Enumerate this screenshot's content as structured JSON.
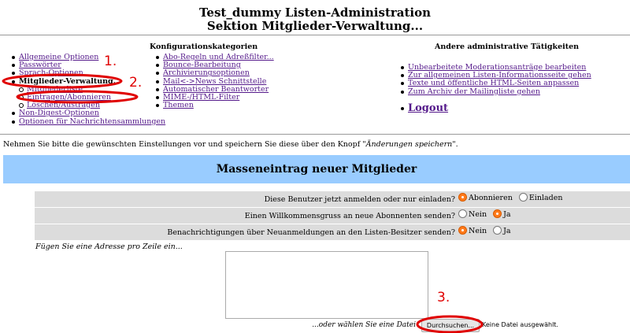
{
  "header": {
    "title_line1": "Test_dummy Listen-Administration",
    "title_line2": "Sektion Mitglieder-Verwaltung..."
  },
  "categories": {
    "heading": "Konfigurationskategorien",
    "col1": [
      {
        "label": "Allgemeine Optionen",
        "type": "link"
      },
      {
        "label": "Passwörter",
        "type": "link"
      },
      {
        "label": "Sprach-Optionen",
        "type": "link"
      },
      {
        "label": "Mitglieder-Verwaltung...",
        "type": "bold"
      },
      {
        "label": "Mitgliederliste",
        "type": "sublink"
      },
      {
        "label": "Eintragen/Abonnieren",
        "type": "sublink"
      },
      {
        "label": "Löschen/Austragen",
        "type": "sublink"
      },
      {
        "label": "Non-Digest-Optionen",
        "type": "link"
      },
      {
        "label": "Optionen für Nachrichtensammlungen",
        "type": "link"
      }
    ],
    "col2": [
      "Abo-Regeln und Adreßfilter...",
      "Bounce-Bearbeitung",
      "Archivierungsoptionen",
      "Mail<->News Schnittstelle",
      "Automatischer Beantworter",
      "MIME-/HTML-Filter",
      "Themen"
    ]
  },
  "other_tasks": {
    "heading": "Andere administrative Tätigkeiten",
    "items": [
      "Unbearbeitete Moderationsanträge bearbeiten",
      "Zur allgemeinen Listen-Informationsseite gehen",
      "Texte und öffentliche HTML-Seiten anpassen",
      "Zum Archiv der Mailingliste gehen"
    ],
    "logout": "Logout"
  },
  "intro": {
    "before": "Nehmen Sie bitte die gewünschten Einstellungen vor und speichern Sie diese über den Knopf \"",
    "emph": "Änderungen speichern",
    "after": "\"."
  },
  "section_title": "Masseneintrag neuer Mitglieder",
  "form": {
    "rows": [
      {
        "question": "Diese Benutzer jetzt anmelden oder nur einladen?",
        "options": [
          "Abonnieren",
          "Einladen"
        ],
        "selected": 0
      },
      {
        "question": "Einen Willkommensgruss an neue Abonnenten senden?",
        "options": [
          "Nein",
          "Ja"
        ],
        "selected": 1
      },
      {
        "question": "Benachrichtigungen über Neuanmeldungen an den Listen-Besitzer senden?",
        "options": [
          "Nein",
          "Ja"
        ],
        "selected": 0
      }
    ],
    "address_hint": "Fügen Sie eine Adresse pro Zeile ein...",
    "textarea_value": "",
    "file_prompt": "...oder wählen Sie eine Datei",
    "browse_label": "Durchsuchen...",
    "no_file": "Keine Datei ausgewählt."
  },
  "annotations": {
    "labels": [
      "1.",
      "2.",
      "3."
    ],
    "color": "#e00000"
  }
}
